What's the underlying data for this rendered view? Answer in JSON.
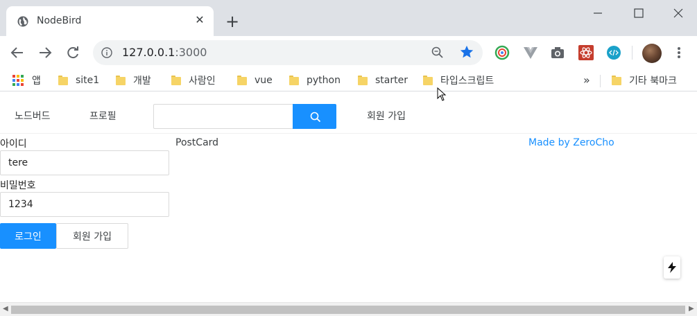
{
  "browser": {
    "tab": {
      "title": "NodeBird",
      "close_glyph": "✕"
    },
    "new_tab_glyph": "+",
    "address": {
      "host": "127.0.0.1",
      "port": ":3000"
    },
    "accent_color": "#1a73e8"
  },
  "bookmarks": {
    "apps_label": "앱",
    "items": [
      {
        "label": "site1"
      },
      {
        "label": "개발"
      },
      {
        "label": "사람인"
      },
      {
        "label": "vue"
      },
      {
        "label": "python"
      },
      {
        "label": "starter"
      },
      {
        "label": "타입스크립트"
      }
    ],
    "overflow_glyph": "»",
    "other_label": "기타 북마크"
  },
  "app": {
    "menu": {
      "home": "노드버드",
      "profile": "프로필",
      "signup": "회원 가입"
    },
    "search": {
      "value": ""
    },
    "primary_color": "#1890ff",
    "login_form": {
      "id_label": "아이디",
      "id_value": "tere",
      "password_label": "비밀번호",
      "password_value": "1234",
      "login_button": "로그인",
      "signup_button": "회원 가입"
    },
    "post_card": "PostCard",
    "made_by": "Made by ZeroCho"
  }
}
